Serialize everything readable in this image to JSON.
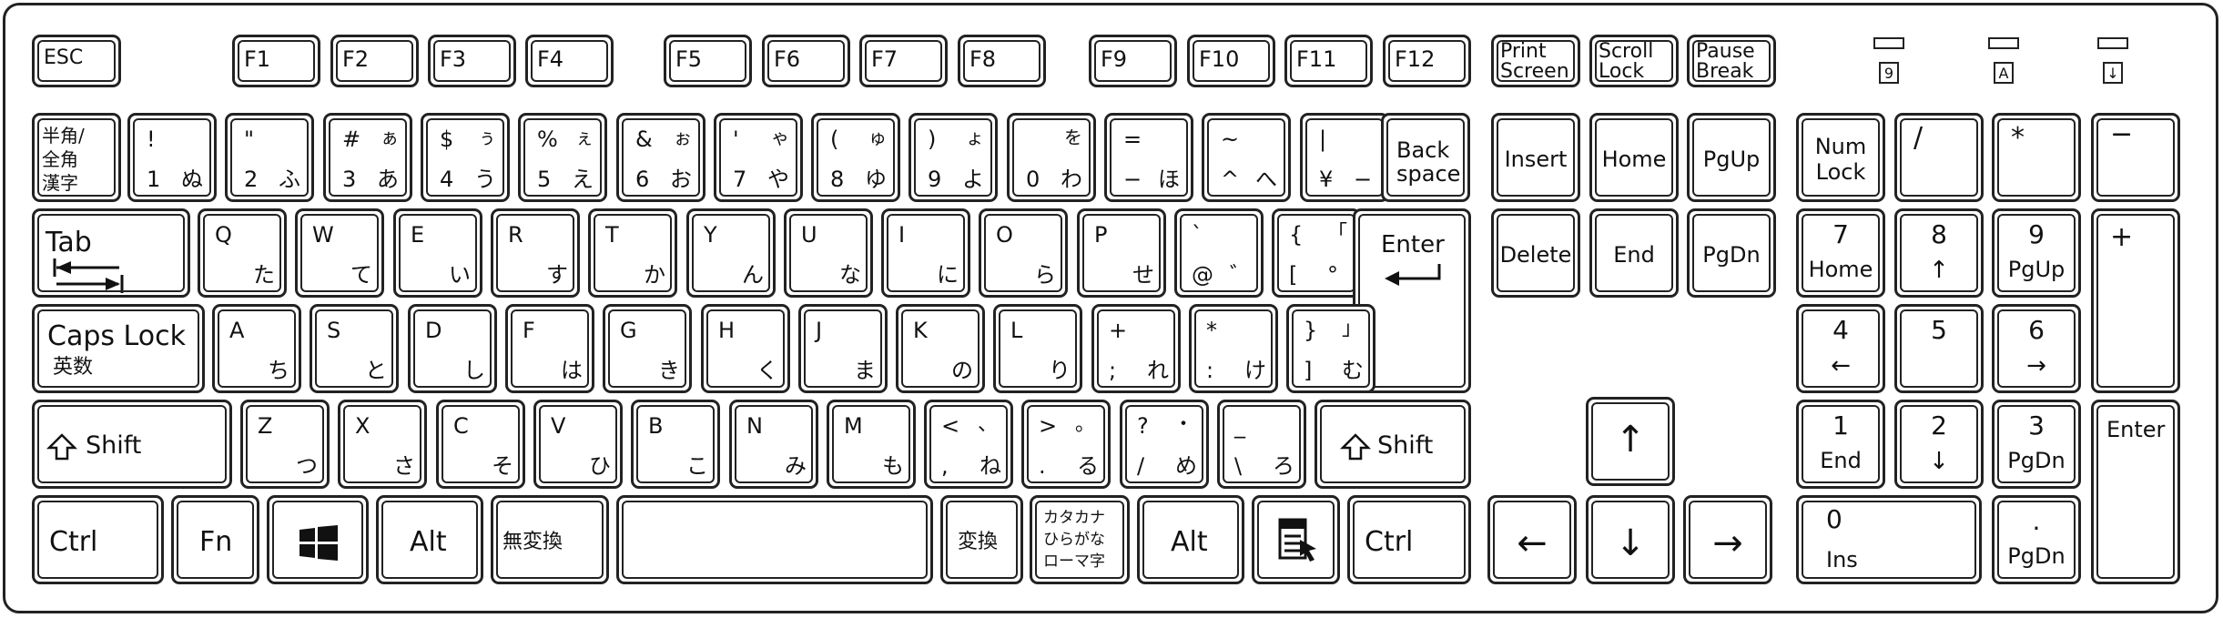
{
  "rows": {
    "fn": {
      "esc": "ESC",
      "f": [
        "F1",
        "F2",
        "F3",
        "F4",
        "F5",
        "F6",
        "F7",
        "F8",
        "F9",
        "F10",
        "F11",
        "F12"
      ],
      "print": [
        "Print",
        "Screen"
      ],
      "scroll": [
        "Scroll",
        "Lock"
      ],
      "pause": [
        "Pause",
        "Break"
      ]
    },
    "num": {
      "hankaku": [
        "半角/",
        "全角",
        "漢字"
      ],
      "keys": [
        {
          "shift": "!",
          "base": "1",
          "kana": "ぬ",
          "kana_shift": ""
        },
        {
          "shift": "\"",
          "base": "2",
          "kana": "ふ",
          "kana_shift": ""
        },
        {
          "shift": "#",
          "base": "3",
          "kana": "あ",
          "kana_shift": "ぁ"
        },
        {
          "shift": "$",
          "base": "4",
          "kana": "う",
          "kana_shift": "ぅ"
        },
        {
          "shift": "%",
          "base": "5",
          "kana": "え",
          "kana_shift": "ぇ"
        },
        {
          "shift": "&",
          "base": "6",
          "kana": "お",
          "kana_shift": "ぉ"
        },
        {
          "shift": "'",
          "base": "7",
          "kana": "や",
          "kana_shift": "ゃ"
        },
        {
          "shift": "(",
          "base": "8",
          "kana": "ゆ",
          "kana_shift": "ゅ"
        },
        {
          "shift": ")",
          "base": "9",
          "kana": "よ",
          "kana_shift": "ょ"
        },
        {
          "shift": "",
          "base": "0",
          "kana": "わ",
          "kana_shift": "を"
        },
        {
          "shift": "=",
          "base": "−",
          "kana": "ほ",
          "kana_shift": ""
        },
        {
          "shift": "~",
          "base": "^",
          "kana": "へ",
          "kana_shift": ""
        },
        {
          "shift": "|",
          "base": "¥",
          "kana": "−",
          "kana_shift": ""
        }
      ],
      "backspace": [
        "Back",
        "space"
      ]
    },
    "tab": {
      "tab": "Tab",
      "keys": [
        {
          "l": "Q",
          "k": "た"
        },
        {
          "l": "W",
          "k": "て"
        },
        {
          "l": "E",
          "k": "い"
        },
        {
          "l": "R",
          "k": "す"
        },
        {
          "l": "T",
          "k": "か"
        },
        {
          "l": "Y",
          "k": "ん"
        },
        {
          "l": "U",
          "k": "な"
        },
        {
          "l": "I",
          "k": "に"
        },
        {
          "l": "O",
          "k": "ら"
        },
        {
          "l": "P",
          "k": "せ"
        },
        {
          "l": "`",
          "k": "゛",
          "l2": "@"
        },
        {
          "l": "{",
          "k": "°",
          "l2": "[",
          "ks": "「"
        }
      ],
      "enter": "Enter"
    },
    "caps": {
      "caps": "Caps Lock",
      "eisu": "英数",
      "keys": [
        {
          "l": "A",
          "k": "ち"
        },
        {
          "l": "S",
          "k": "と"
        },
        {
          "l": "D",
          "k": "し"
        },
        {
          "l": "F",
          "k": "は"
        },
        {
          "l": "G",
          "k": "き"
        },
        {
          "l": "H",
          "k": "く"
        },
        {
          "l": "J",
          "k": "ま"
        },
        {
          "l": "K",
          "k": "の"
        },
        {
          "l": "L",
          "k": "り"
        },
        {
          "l": "+",
          "k": "れ",
          "l2": ";"
        },
        {
          "l": "*",
          "k": "け",
          "l2": ":"
        },
        {
          "l": "}",
          "k": "む",
          "l2": "]",
          "ks": "」"
        }
      ]
    },
    "shift": {
      "shift": "Shift",
      "keys": [
        {
          "l": "Z",
          "k": "つ"
        },
        {
          "l": "X",
          "k": "さ"
        },
        {
          "l": "C",
          "k": "そ"
        },
        {
          "l": "V",
          "k": "ひ"
        },
        {
          "l": "B",
          "k": "こ"
        },
        {
          "l": "N",
          "k": "み"
        },
        {
          "l": "M",
          "k": "も"
        },
        {
          "l": "<",
          "k": "ね",
          "l2": ",",
          "ks": "、"
        },
        {
          "l": ">",
          "k": "る",
          "l2": ".",
          "ks": "。"
        },
        {
          "l": "?",
          "k": "め",
          "l2": "/",
          "ks": "・"
        },
        {
          "l": "_",
          "k": "ろ",
          "l2": "\\"
        }
      ]
    },
    "bottom": {
      "ctrl": "Ctrl",
      "fn": "Fn",
      "alt": "Alt",
      "muhenkan": "無変換",
      "henkan": "変換",
      "kana": [
        "カタカナ",
        "ひらがな",
        "ローマ字"
      ]
    }
  },
  "nav": {
    "insert": "Insert",
    "home": "Home",
    "pgup": "PgUp",
    "delete": "Delete",
    "end": "End",
    "pgdn": "PgDn",
    "arrows": {
      "up": "↑",
      "down": "↓",
      "left": "←",
      "right": "→"
    }
  },
  "leds": [
    "9",
    "A",
    "↓"
  ],
  "numpad": {
    "numlock": [
      "Num",
      "Lock"
    ],
    "div": "/",
    "mul": "*",
    "minus": "−",
    "plus": "+",
    "enter": "Enter",
    "k7": [
      "7",
      "Home"
    ],
    "k8": [
      "8",
      "↑"
    ],
    "k9": [
      "9",
      "PgUp"
    ],
    "k4": [
      "4",
      "←"
    ],
    "k5": [
      "5"
    ],
    "k6": [
      "6",
      "→"
    ],
    "k1": [
      "1",
      "End"
    ],
    "k2": [
      "2",
      "↓"
    ],
    "k3": [
      "3",
      "PgDn"
    ],
    "k0": [
      "0",
      "Ins"
    ],
    "dot": [
      ".",
      "PgDn"
    ]
  }
}
